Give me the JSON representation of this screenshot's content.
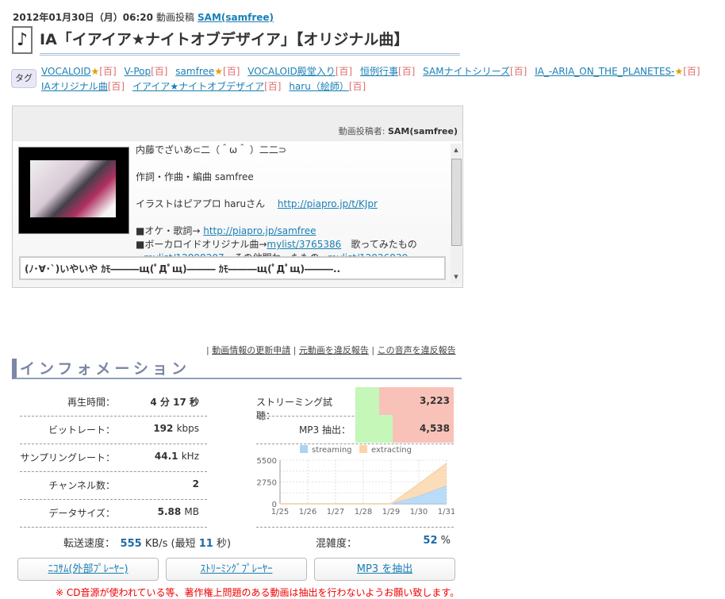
{
  "header": {
    "date": "2012年01月30日（月）06:20",
    "action": "動画投稿",
    "user": "SAM(samfree)",
    "title": "IA「イアイア★ナイトオブデザイア」【オリジナル曲】",
    "note_icon": "♪"
  },
  "tags": {
    "label": "タグ",
    "dic": "[百]",
    "items": [
      {
        "name": "VOCALOID",
        "star": true
      },
      {
        "name": "V-Pop",
        "star": false
      },
      {
        "name": "samfree",
        "star": true
      },
      {
        "name": "VOCALOID殿堂入り",
        "star": false
      },
      {
        "name": "恒例行事",
        "star": false
      },
      {
        "name": "SAMナイトシリーズ",
        "star": false
      },
      {
        "name": "IA_-ARIA_ON_THE_PLANETES-",
        "star": true
      },
      {
        "name": "IAオリジナル曲",
        "star": false
      },
      {
        "name": "イアイア★ナイトオブデザイア",
        "star": false
      },
      {
        "name": "haru（絵師）",
        "star": false
      }
    ]
  },
  "description": {
    "poster_label": "動画投稿者:",
    "poster": "SAM(samfree)",
    "line1": "内藤でざいあ⊂二（＾ω＾ ）二二⊃",
    "line2": "作詞・作曲・編曲 samfree",
    "line3": "イラストはピアプロ haruさん",
    "link1": "http://piapro.jp/t/KJpr",
    "line4": "■オケ・歌詞→ ",
    "link2": "http://piapro.jp/samfree",
    "line5": "■ボーカロイドオリジナル曲→",
    "link3": "mylist/3765386",
    "line5b": "　歌ってみたもの",
    "line6": "→",
    "link4": "mylist/12898207",
    "line6b": "　その他関わったもの→",
    "link5": "mylist/12926839",
    "comment": "(ﾉ･∀･`)いやいや ｶﾓ―――щ(ﾟДﾟщ)――― ｶﾓ―――щ(ﾟДﾟщ)―――.."
  },
  "report_links": [
    "動画情報の更新申請",
    "元動画を違反報告",
    "この音声を違反報告"
  ],
  "info": {
    "heading": "インフォメーション",
    "left": [
      {
        "label": "再生時間：",
        "value": "4 分 17 秒"
      },
      {
        "label": "ビットレート：",
        "value": "192",
        "unit": "kbps"
      },
      {
        "label": "サンプリングレート：",
        "value": "44.1",
        "unit": "kHz"
      },
      {
        "label": "チャンネル数：",
        "value": "2"
      },
      {
        "label": "データサイズ：",
        "value": "5.88",
        "unit": "MB"
      }
    ],
    "right": [
      {
        "label": "ストリーミング試聴：",
        "value": "3,223",
        "fill": 0.24
      },
      {
        "label": "MP3 抽出：",
        "value": "4,538",
        "fill": 0.38
      }
    ],
    "speed_label": "転送速度：",
    "speed": "555",
    "speed_unit": "KB/s (最短",
    "speed_sec": "11",
    "speed_end": "秒)",
    "crowd_label": "混雑度：",
    "crowd": "52",
    "crowd_unit": "%"
  },
  "chart_data": {
    "type": "area",
    "stacked": true,
    "categories": [
      "1/25",
      "1/26",
      "1/27",
      "1/28",
      "1/29",
      "1/30",
      "1/31"
    ],
    "series": [
      {
        "name": "streaming",
        "color": "#a8d4f8",
        "values": [
          0,
          0,
          0,
          0,
          0,
          970,
          2265
        ]
      },
      {
        "name": "extracting",
        "color": "#fad4a8",
        "values": [
          0,
          0,
          0,
          0,
          0,
          1550,
          2845
        ]
      }
    ],
    "yticks": [
      0,
      2750,
      5500
    ],
    "ylim": [
      0,
      5500
    ],
    "legend": "top"
  },
  "buttons": [
    "ﾆｺｻﾑ(外部ﾌﾟﾚｰﾔｰ)",
    "ｽﾄﾘｰﾐﾝｸﾞﾌﾟﾚｰﾔｰ",
    "MP3 を抽出"
  ],
  "warning": "※ CD音源が使われている等、著作権上問題のある動画は抽出を行わないようお願い致します。"
}
